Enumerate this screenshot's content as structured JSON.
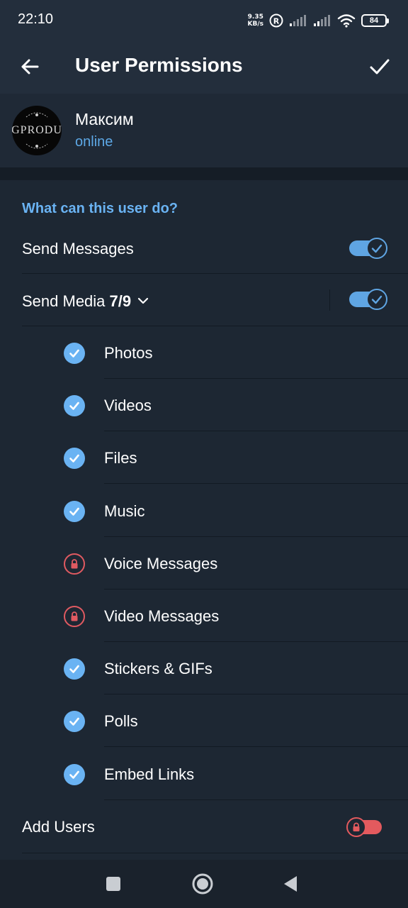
{
  "status_bar": {
    "time": "22:10",
    "net_speed_value": "9.35",
    "net_speed_unit": "KB/s",
    "roaming_label": "R",
    "battery_level": "84"
  },
  "app_bar": {
    "title": "User Permissions"
  },
  "user": {
    "name": "Максим",
    "status": "online",
    "avatar_text": "GPRODU"
  },
  "section": {
    "header": "What can this user do?"
  },
  "permissions": {
    "send_messages": {
      "label": "Send Messages",
      "enabled": true
    },
    "send_media": {
      "label": "Send Media",
      "count": "7/9",
      "enabled": true
    },
    "add_users": {
      "label": "Add Users",
      "enabled": false,
      "locked": true
    }
  },
  "media_items": [
    {
      "label": "Photos",
      "state": "checked"
    },
    {
      "label": "Videos",
      "state": "checked"
    },
    {
      "label": "Files",
      "state": "checked"
    },
    {
      "label": "Music",
      "state": "checked"
    },
    {
      "label": "Voice Messages",
      "state": "locked"
    },
    {
      "label": "Video Messages",
      "state": "locked"
    },
    {
      "label": "Stickers & GIFs",
      "state": "checked"
    },
    {
      "label": "Polls",
      "state": "checked"
    },
    {
      "label": "Embed Links",
      "state": "checked"
    }
  ],
  "colors": {
    "accent": "#6ab3f3",
    "toggle_on": "#5fa5e3",
    "locked": "#e05a61",
    "background": "#1d2733",
    "header_bg": "#232e3c"
  }
}
